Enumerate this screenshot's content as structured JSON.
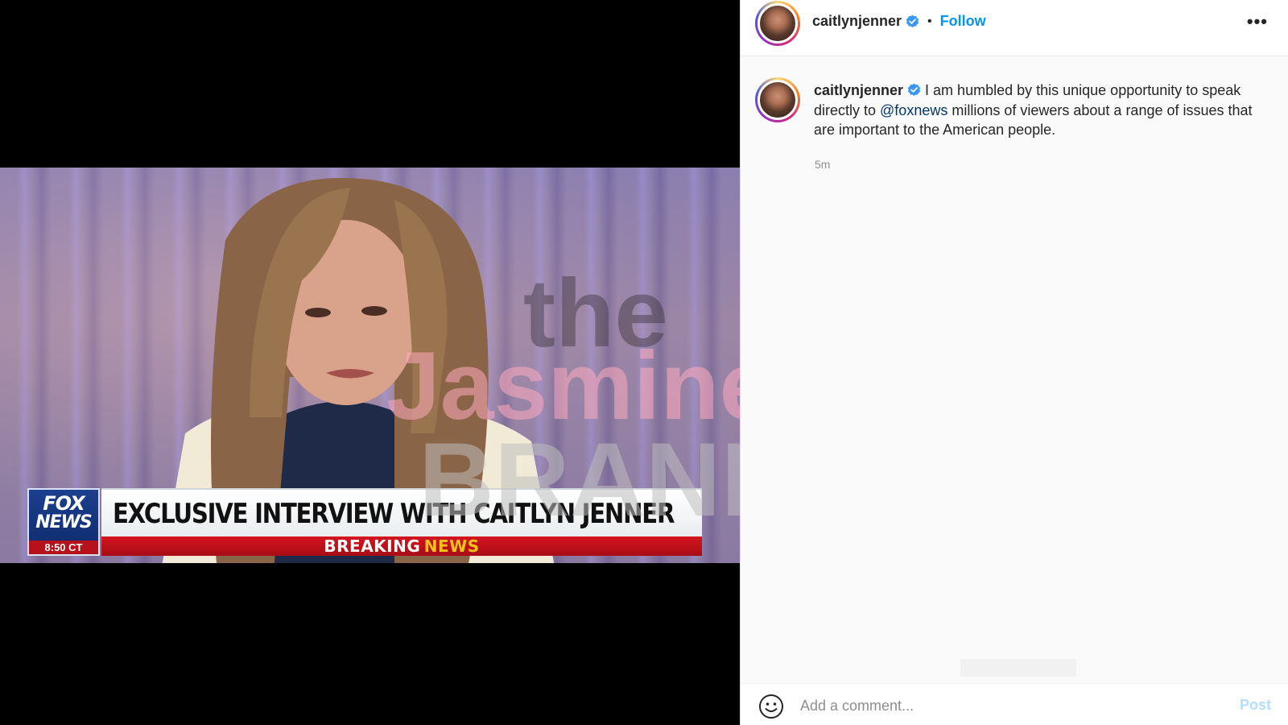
{
  "media": {
    "lower_third": {
      "logo_line1": "FOX",
      "logo_line2": "NEWS",
      "time": "8:50 CT",
      "headline": "EXCLUSIVE INTERVIEW WITH CAITLYN JENNER",
      "breaking_word1": "BREAKING",
      "breaking_word2": "NEWS"
    },
    "watermark": {
      "line1": "the",
      "line2": "Jasmine",
      "line3": "BRAND"
    }
  },
  "post": {
    "header": {
      "username": "caitlynjenner",
      "separator": "•",
      "follow_label": "Follow",
      "more_label": "•••"
    },
    "caption": {
      "username": "caitlynjenner",
      "text_before_mention": " I am humbled by this unique opportunity to speak directly to ",
      "mention": "@foxnews",
      "text_after_mention": " millions of viewers about a range of issues that are important to the American people."
    },
    "time_ago": "5m",
    "comment": {
      "placeholder": "Add a comment...",
      "post_label": "Post"
    }
  },
  "colors": {
    "follow_blue": "#0095f6",
    "verified_blue": "#3897f0",
    "mention_blue": "#00376b",
    "fox_red": "#d4141f",
    "breaking_yellow": "#f2c21b"
  },
  "icons": {
    "verified": "verified-badge-icon",
    "emoji": "smiley-icon",
    "more": "more-options-icon"
  }
}
